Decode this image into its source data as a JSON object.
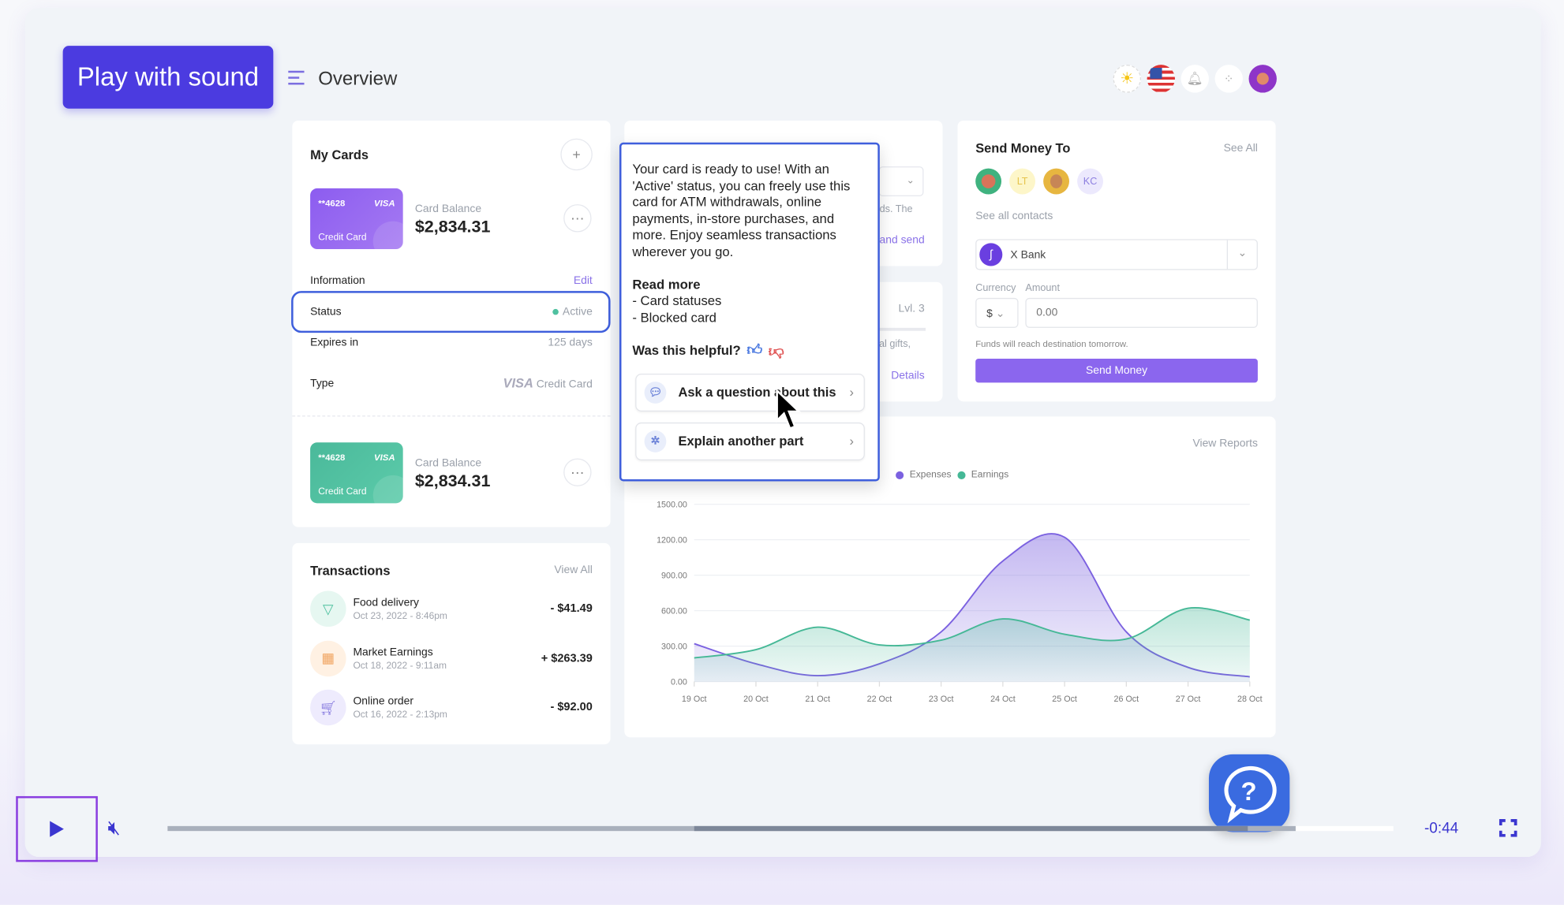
{
  "promo": {
    "play_with_sound": "Play with sound"
  },
  "header": {
    "title": "Overview",
    "icons": [
      "sun-icon",
      "us-flag-icon",
      "bell-icon",
      "apps-grid-icon",
      "user-avatar"
    ]
  },
  "my_cards": {
    "title": "My Cards",
    "add": "+",
    "cards": [
      {
        "number": "**4628",
        "brand": "VISA",
        "type": "Credit Card",
        "balance_label": "Card Balance",
        "balance": "$2,834.31",
        "color": "#8f63ef"
      },
      {
        "number": "**4628",
        "brand": "VISA",
        "type": "Credit Card",
        "balance_label": "Card Balance",
        "balance": "$2,834.31",
        "color": "#4fc1a0"
      }
    ],
    "info_label": "Information",
    "edit": "Edit",
    "status_label": "Status",
    "status_value": "Active",
    "expires_label": "Expires in",
    "expires_value": "125 days",
    "type_label": "Type",
    "type_brand": "VISA",
    "type_value": "Credit Card"
  },
  "transactions": {
    "title": "Transactions",
    "view_all": "View All",
    "items": [
      {
        "name": "Food delivery",
        "date": "Oct 23, 2022 - 8:46pm",
        "amount": "- $41.49"
      },
      {
        "name": "Market Earnings",
        "date": "Oct 18, 2022 - 9:11am",
        "amount": "+ $263.39"
      },
      {
        "name": "Online order",
        "date": "Oct 16, 2022 - 2:13pm",
        "amount": "- $92.00"
      }
    ]
  },
  "hidden_card": {
    "frag1": "ds. The",
    "frag2": "and send",
    "frag3": "Lvl. 3",
    "frag4": "al gifts,",
    "frag5": "Details"
  },
  "popover": {
    "body": "Your card is ready to use! With an 'Active' status, you can freely use this card for ATM withdrawals, online payments, in-store purchases, and more. Enjoy seamless transactions wherever you go.",
    "read_more": "Read more",
    "links": [
      "- Card statuses",
      "- Blocked card"
    ],
    "helpful": "Was this helpful?",
    "ask": "Ask a question about this",
    "explain": "Explain another part"
  },
  "send_money": {
    "title": "Send Money To",
    "see_all": "See All",
    "contacts": [
      "LT",
      "KC"
    ],
    "see_contacts": "See all contacts",
    "bank": "X Bank",
    "currency_label": "Currency",
    "amount_label": "Amount",
    "currency": "$",
    "amount_placeholder": "0.00",
    "note": "Funds will reach destination tomorrow.",
    "button": "Send Money"
  },
  "chart_card": {
    "view_reports": "View Reports"
  },
  "chart_data": {
    "type": "area",
    "x": [
      "19 Oct",
      "20 Oct",
      "21 Oct",
      "22 Oct",
      "23 Oct",
      "24 Oct",
      "25 Oct",
      "26 Oct",
      "27 Oct",
      "28 Oct"
    ],
    "yticks": [
      "0.00",
      "300.00",
      "600.00",
      "900.00",
      "1200.00",
      "1500.00"
    ],
    "ylim": [
      0,
      1500
    ],
    "grid": true,
    "legend": "top-left",
    "series": [
      {
        "name": "Expenses",
        "color": "#7b61e0",
        "values": [
          320,
          150,
          50,
          150,
          420,
          1020,
          1220,
          420,
          120,
          40
        ]
      },
      {
        "name": "Earnings",
        "color": "#45b896",
        "values": [
          200,
          270,
          460,
          310,
          350,
          530,
          400,
          360,
          620,
          520
        ]
      }
    ]
  },
  "player": {
    "time": "-0:44",
    "progress": 0.43,
    "buffered": 0.92
  }
}
